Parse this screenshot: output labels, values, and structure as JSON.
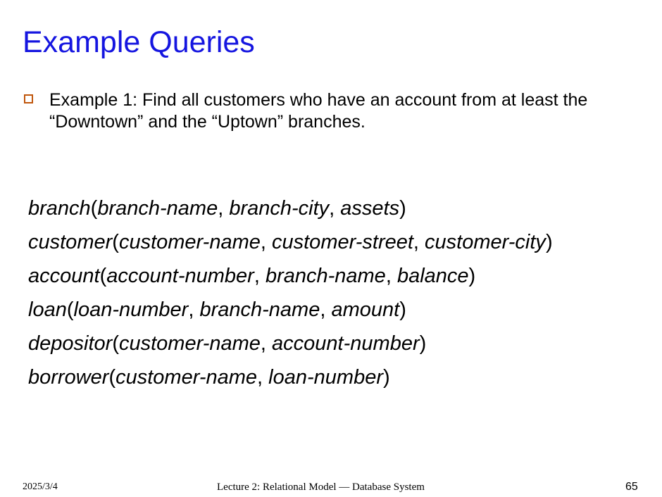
{
  "slide": {
    "title": "Example Queries",
    "bullet_text": "Example 1: Find all customers who have an account from at least the “Downtown” and the “Uptown” branches.",
    "bullet_color": "#c0560c",
    "title_color": "#1515e0"
  },
  "schema": [
    {
      "relation": "branch",
      "attributes": [
        "branch-name",
        "branch-city",
        "assets"
      ]
    },
    {
      "relation": "customer",
      "attributes": [
        "customer-name",
        "customer-street",
        "customer-city"
      ]
    },
    {
      "relation": "account",
      "attributes": [
        "account-number",
        "branch-name",
        "balance"
      ]
    },
    {
      "relation": "loan",
      "attributes": [
        "loan-number",
        "branch-name",
        "amount"
      ]
    },
    {
      "relation": "depositor",
      "attributes": [
        "customer-name",
        "account-number"
      ]
    },
    {
      "relation": "borrower",
      "attributes": [
        "customer-name",
        "loan-number"
      ]
    }
  ],
  "footer": {
    "date": "2025/3/4",
    "center": "Lecture 2: Relational Model — Database System",
    "page": "65"
  }
}
